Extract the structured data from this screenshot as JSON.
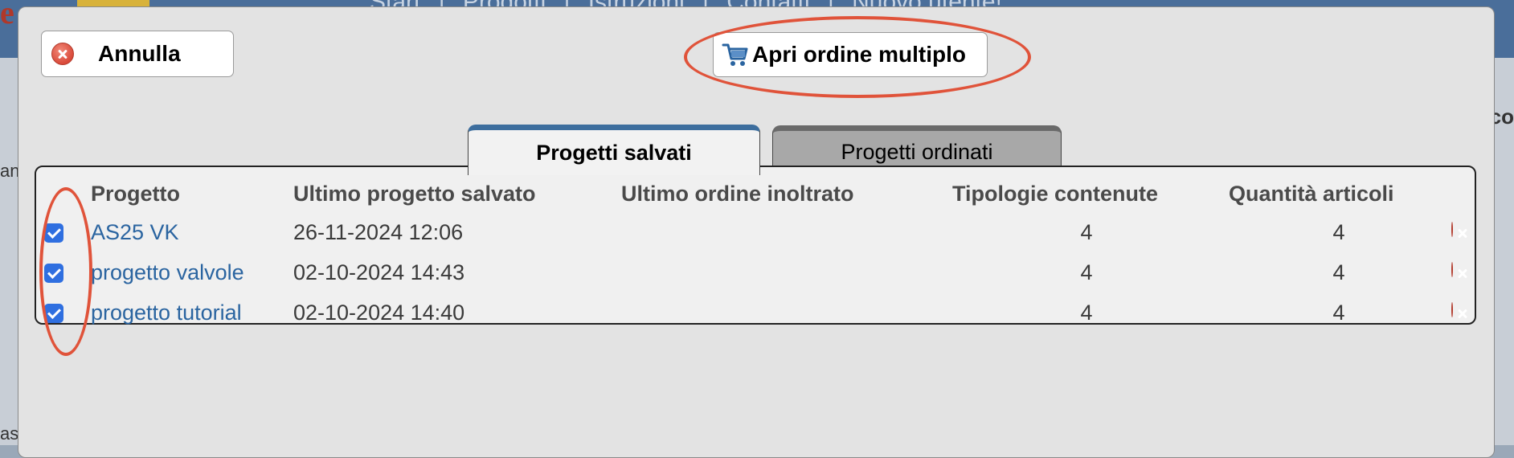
{
  "background": {
    "nav_items": [
      "Start",
      "|",
      "Prodotti",
      "|",
      "Istruzioni",
      "|",
      "Contatti",
      "|",
      "Nuovo utente!"
    ],
    "left_fragments": [
      "e",
      "ant",
      "as"
    ],
    "right_fragment": "co"
  },
  "dialog": {
    "cancel_label": "Annulla",
    "open_order_label": "Apri ordine multiplo",
    "tabs": [
      {
        "label": "Progetti salvati",
        "active": true
      },
      {
        "label": "Progetti ordinati",
        "active": false
      }
    ],
    "table": {
      "headers": {
        "project": "Progetto",
        "last_saved": "Ultimo progetto salvato",
        "last_order": "Ultimo ordine inoltrato",
        "types": "Tipologie contenute",
        "quantity": "Quantità articoli"
      },
      "rows": [
        {
          "checked": true,
          "project": "AS25 VK",
          "last_saved": "26-11-2024 12:06",
          "last_order": "",
          "types": "4",
          "quantity": "4"
        },
        {
          "checked": true,
          "project": "progetto valvole",
          "last_saved": "02-10-2024 14:43",
          "last_order": "",
          "types": "4",
          "quantity": "4"
        },
        {
          "checked": true,
          "project": "progetto tutorial",
          "last_saved": "02-10-2024 14:40",
          "last_order": "",
          "types": "4",
          "quantity": "4"
        }
      ]
    }
  },
  "colors": {
    "accent": "#3d6e9e",
    "link": "#2a64a0",
    "annotation": "#e0533a",
    "checkbox": "#2f6fe0"
  }
}
